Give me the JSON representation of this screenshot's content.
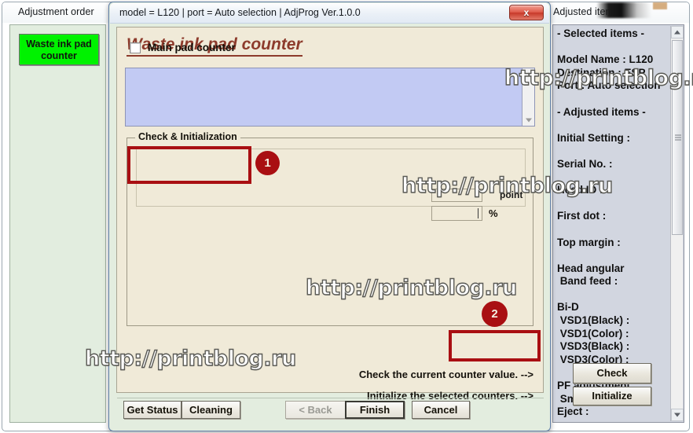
{
  "back_window": {
    "left_panel_title": "Adjustment order",
    "right_panel_title": "Adjusted items",
    "order_items": [
      {
        "label": "Waste ink pad counter"
      }
    ],
    "adjusted_items_text": "- Selected items -\n\nModel Name : L120\nDestination : ESP\nPort : Auto selection\n\n- Adjusted items -\n\nInitial Setting :\n\nSerial No. :\n\nHead ID :\n\nFirst dot :\n\nTop margin :\n\nHead angular\n Band feed :\n\nBi-D\n VSD1(Black) :\n VSD1(Color) :\n VSD3(Black) :\n VSD3(Color) :\n\nPF adjustment\n Smap :\nEject :"
  },
  "dialog": {
    "titlebar": "model = L120 | port = Auto selection | AdjProg Ver.1.0.0",
    "close_label": "x",
    "header_title": "Waste ink pad counter",
    "message_box_value": "",
    "group": {
      "legend": "Check & Initialization",
      "checkbox": {
        "label": "Main pad counter",
        "checked": false
      },
      "point_label": "point",
      "point_value": "",
      "percent_value": "",
      "percent_label": "%"
    },
    "actions": {
      "check_text": "Check the current counter value. -->",
      "check_button": "Check",
      "initialize_text": "Initialize the selected counters. -->",
      "initialize_button": "Initialize"
    },
    "footer": {
      "get_status": "Get Status",
      "cleaning": "Cleaning",
      "back": "< Back",
      "finish": "Finish",
      "cancel": "Cancel"
    }
  },
  "annotations": {
    "badge_1": "1",
    "badge_2": "2",
    "accent_color": "#a90f12"
  },
  "watermark": {
    "text": "http://printblog.ru"
  }
}
